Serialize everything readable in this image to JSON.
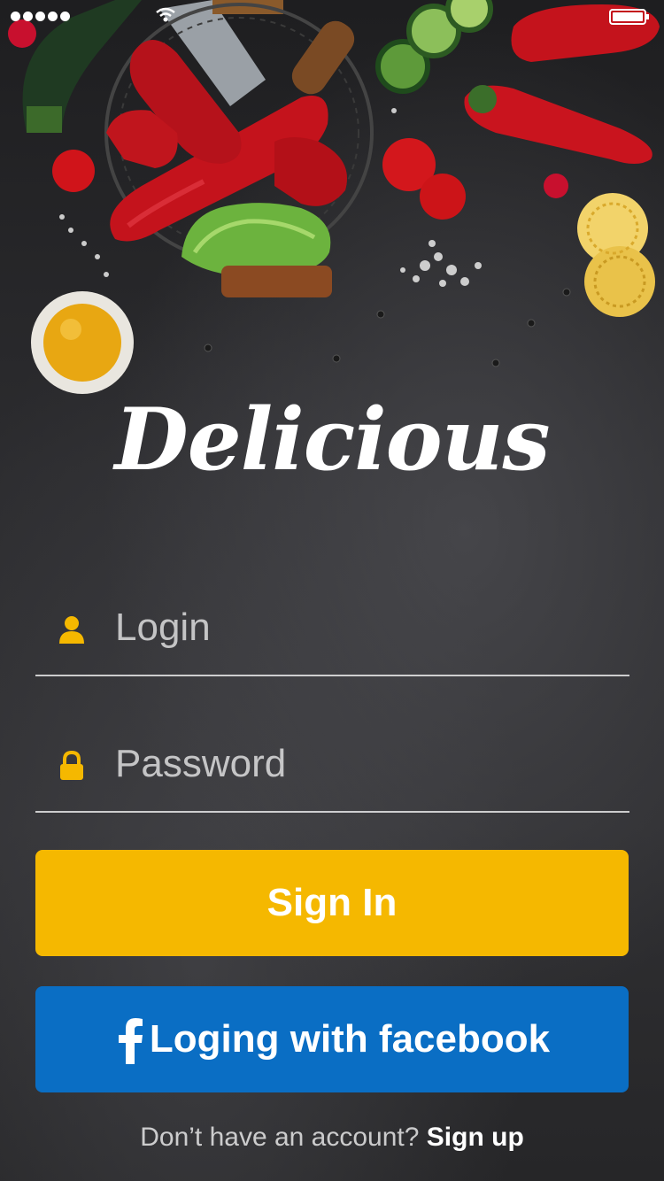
{
  "app": {
    "logo_text": "Delicious"
  },
  "status_bar": {
    "signal": "signal-dots-icon",
    "wifi": "wifi-icon",
    "battery": "battery-icon"
  },
  "login_field": {
    "placeholder": "Login",
    "value": "",
    "icon": "user-icon"
  },
  "password_field": {
    "placeholder": "Password",
    "value": "",
    "icon": "lock-icon"
  },
  "signin_button": {
    "label": "Sign In"
  },
  "facebook_button": {
    "label": "Loging with facebook",
    "icon": "facebook-icon"
  },
  "footer": {
    "prompt": "Don’t have an account?",
    "link": "Sign up"
  },
  "colors": {
    "accent": "#f5b800",
    "facebook": "#0a6ec4",
    "background": "#2a2a2c"
  }
}
